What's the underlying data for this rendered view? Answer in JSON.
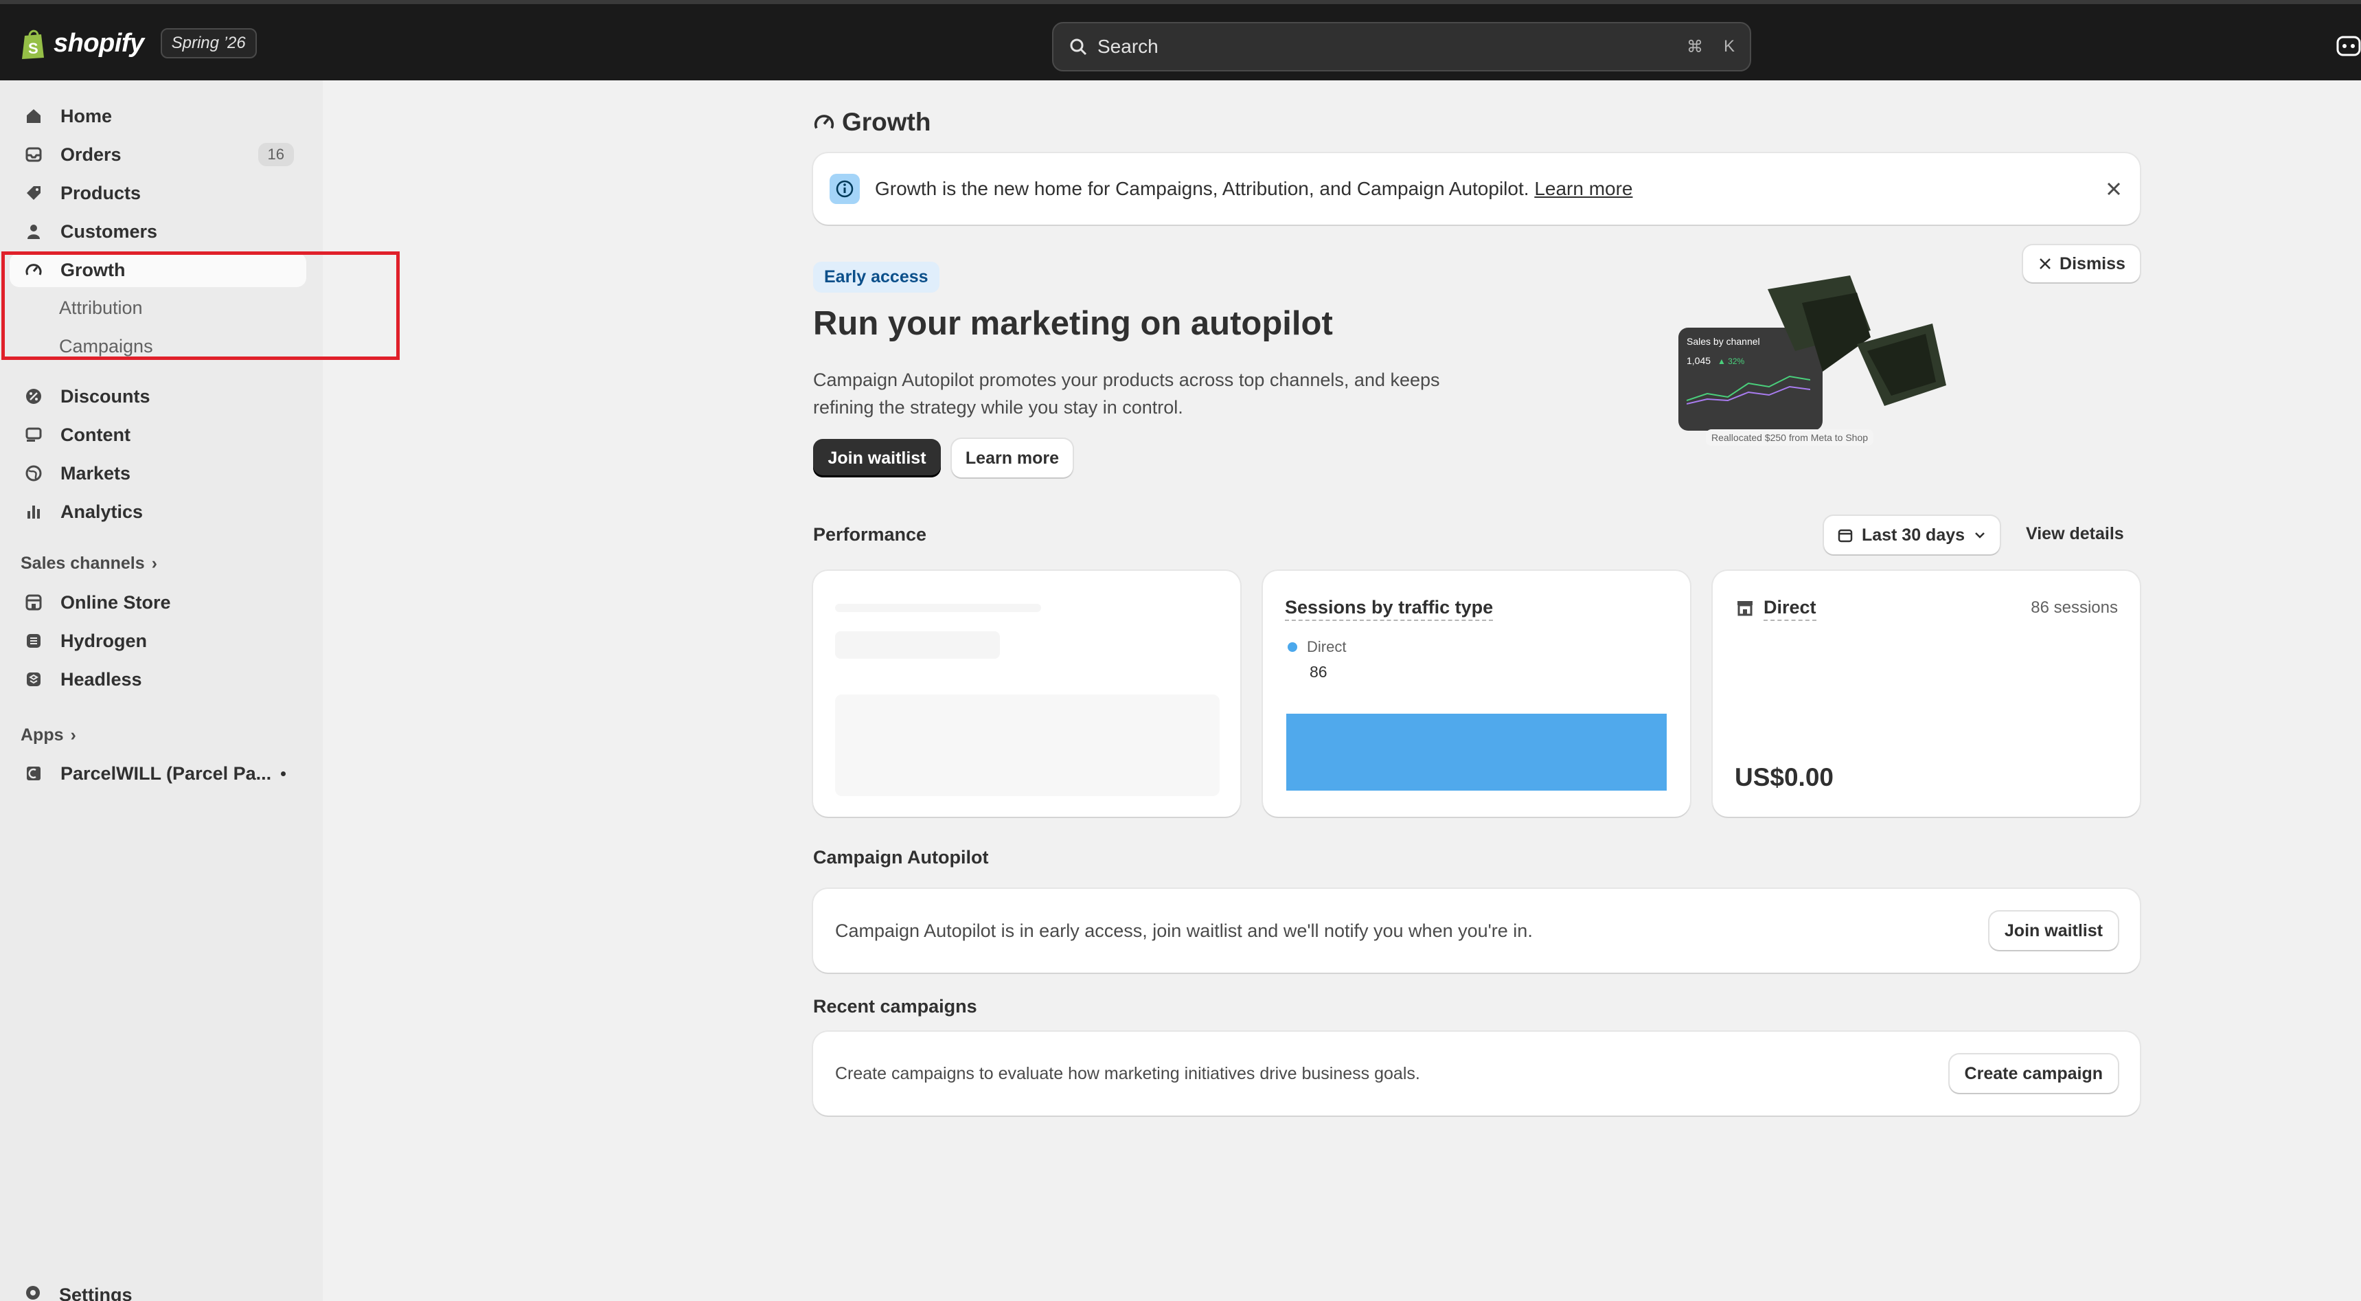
{
  "topbar": {
    "brand": "shopify",
    "edition": "Spring ’26",
    "search_placeholder": "Search",
    "search_shortcut_cmd": "⌘",
    "search_shortcut_key": "K"
  },
  "sidebar": {
    "items": [
      {
        "label": "Home",
        "icon": "home-icon"
      },
      {
        "label": "Orders",
        "icon": "orders-icon",
        "badge": "16"
      },
      {
        "label": "Products",
        "icon": "tag-icon"
      },
      {
        "label": "Customers",
        "icon": "person-icon"
      },
      {
        "label": "Growth",
        "icon": "gauge-icon",
        "active": true
      },
      {
        "label": "Discounts",
        "icon": "discount-icon"
      },
      {
        "label": "Content",
        "icon": "content-icon"
      },
      {
        "label": "Markets",
        "icon": "globe-icon"
      },
      {
        "label": "Analytics",
        "icon": "bar-chart-icon"
      }
    ],
    "growth_subitems": [
      "Attribution",
      "Campaigns"
    ],
    "sales_channels_label": "Sales channels",
    "channels": [
      {
        "label": "Online Store",
        "icon": "store-icon"
      },
      {
        "label": "Hydrogen",
        "icon": "hydrogen-icon"
      },
      {
        "label": "Headless",
        "icon": "headless-icon"
      }
    ],
    "apps_label": "Apps",
    "apps": [
      {
        "label": "ParcelWILL (Parcel Pa...",
        "icon": "app-icon"
      }
    ],
    "settings_label": "Settings"
  },
  "page": {
    "title": "Growth",
    "banner": {
      "text": "Growth is the new home for Campaigns, Attribution, and Campaign Autopilot.",
      "link": "Learn more"
    },
    "hero": {
      "badge": "Early access",
      "title": "Run your marketing on autopilot",
      "description": "Campaign Autopilot promotes your products across top channels, and keeps refining the strategy while you stay in control.",
      "primary_button": "Join waitlist",
      "secondary_button": "Learn more",
      "dismiss": "Dismiss",
      "image_card_title": "Sales by channel",
      "image_card_value": "1,045",
      "image_card_pct": "▲ 32%",
      "image_card_note": "Reallocated $250 from Meta to Shop"
    },
    "performance": {
      "title": "Performance",
      "date_range": "Last 30 days",
      "view_details": "View details",
      "sessions_card": {
        "title": "Sessions by traffic type",
        "legend": "Direct",
        "value": "86",
        "bar_fraction": 1.0
      },
      "direct_card": {
        "title": "Direct",
        "sessions": "86 sessions",
        "amount": "US$0.00"
      }
    },
    "autopilot": {
      "title": "Campaign Autopilot",
      "message": "Campaign Autopilot is in early access, join waitlist and we'll notify you when you're in.",
      "button": "Join waitlist"
    },
    "recent": {
      "title": "Recent campaigns",
      "message": "Create campaigns to evaluate how marketing initiatives drive business goals.",
      "button": "Create campaign"
    }
  },
  "colors": {
    "topbar": "#1a1a1a",
    "sidebar": "#ebebeb",
    "bar": "#50a9ec",
    "highlight": "#e0202a"
  }
}
